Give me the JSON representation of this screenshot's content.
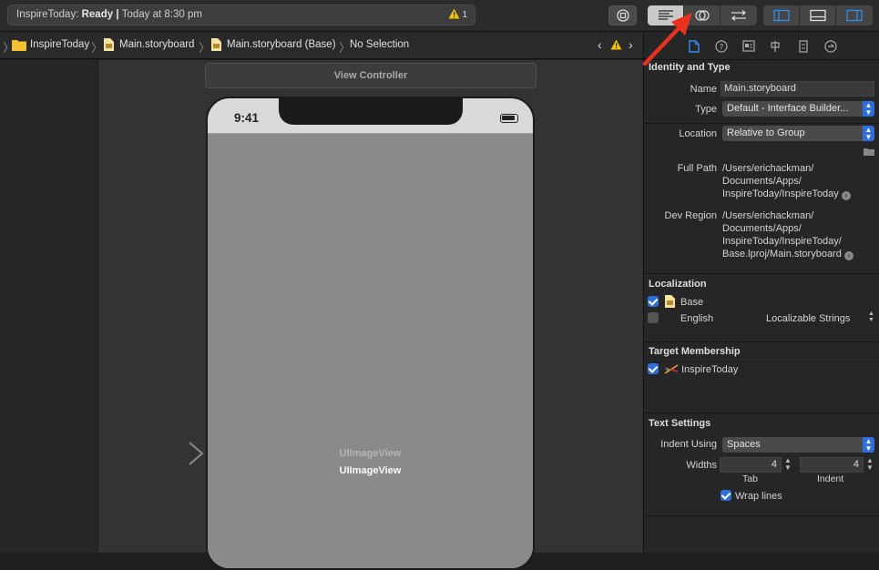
{
  "toolbar": {
    "status_project": "InspireToday: ",
    "status_state": "Ready",
    "status_sep": " | ",
    "status_time": "Today at 8:30 pm",
    "warning_count": "1"
  },
  "jumpbar": {
    "crumbs": [
      "InspireToday",
      "Main.storyboard",
      "Main.storyboard (Base)",
      "No Selection"
    ]
  },
  "canvas": {
    "scene_title": "View Controller",
    "status_time": "9:41",
    "image_view_label_1": "UIImageView",
    "image_view_label_2": "UIImageView"
  },
  "inspector": {
    "identity": {
      "title": "Identity and Type",
      "name_label": "Name",
      "name_value": "Main.storyboard",
      "type_label": "Type",
      "type_value": "Default - Interface Builder...",
      "location_label": "Location",
      "location_value": "Relative to Group",
      "fullpath_label": "Full Path",
      "fullpath_lines": [
        "/Users/erichackman/",
        "Documents/Apps/",
        "InspireToday/InspireToday"
      ],
      "devregion_label": "Dev Region",
      "devregion_lines": [
        "/Users/erichackman/",
        "Documents/Apps/",
        "InspireToday/InspireToday/",
        "Base.lproj/Main.storyboard"
      ]
    },
    "localization": {
      "title": "Localization",
      "base_label": "Base",
      "english_label": "English",
      "english_type": "Localizable Strings"
    },
    "target": {
      "title": "Target Membership",
      "target_label": "InspireToday"
    },
    "text_settings": {
      "title": "Text Settings",
      "indent_label": "Indent Using",
      "indent_value": "Spaces",
      "widths_label": "Widths",
      "tab_value": "4",
      "tab_label": "Tab",
      "indent_width_value": "4",
      "indent_width_label": "Indent",
      "wrap_label": "Wrap lines"
    }
  },
  "colors": {
    "accent": "#2f6fdc",
    "annotation_arrow": "#e8321e"
  }
}
